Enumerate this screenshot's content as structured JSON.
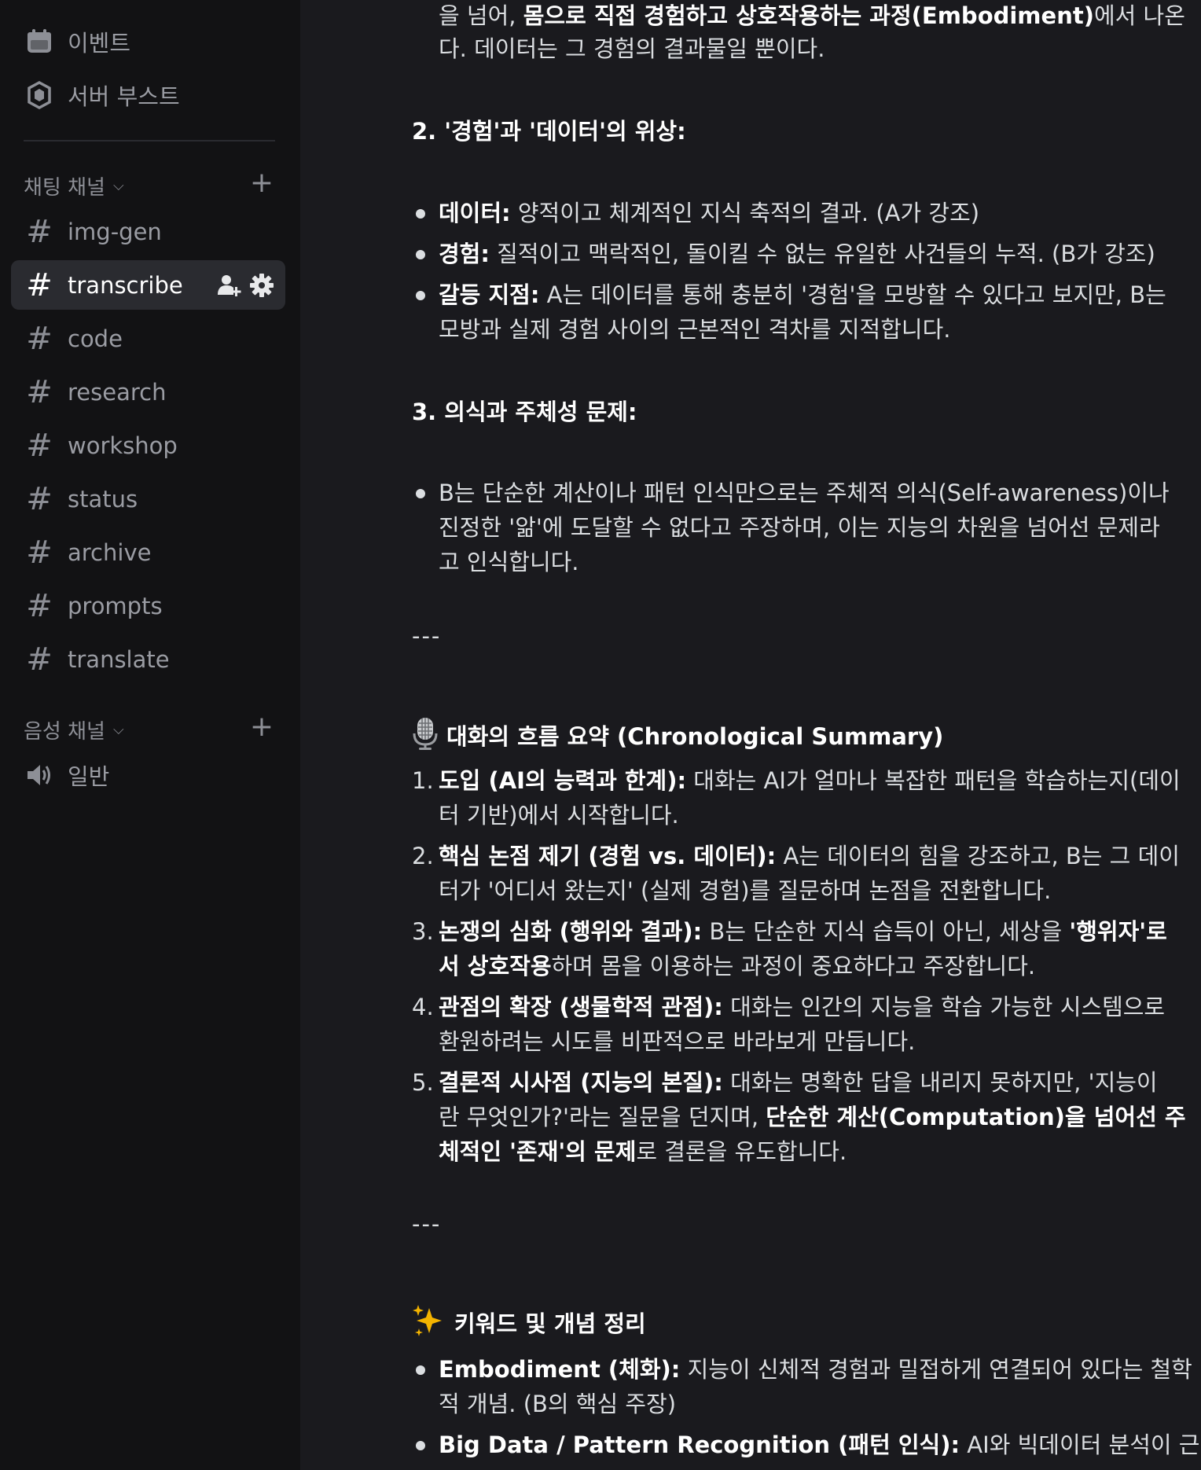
{
  "sidebar": {
    "top_items": [
      {
        "label": "이벤트",
        "icon": "calendar-icon"
      },
      {
        "label": "서버 부스트",
        "icon": "boost-icon"
      }
    ],
    "text_category": {
      "label": "채팅 채널",
      "icon": "chevron-down-icon"
    },
    "channels": [
      "img-gen",
      "transcribe",
      "code",
      "research",
      "workshop",
      "status",
      "archive",
      "prompts",
      "translate"
    ],
    "selected_channel": "transcribe",
    "voice_category": {
      "label": "음성 채널"
    },
    "voice_channels": [
      "일반"
    ]
  },
  "message": {
    "p0_l1_a": "을 넘어, ",
    "p0_l1_b": "몸으로 직접 경험하고 상호작용하는 과정(Embodiment)",
    "p0_l1_c": "에서 나온",
    "p0_l2": "다. 데이터는 그 경험의 결과물일 뿐이다.",
    "s2_heading": "2. '경험'과 '데이터'의 위상:",
    "s2_b1_label": "데이터:",
    "s2_b1_text": " 양적이고 체계적인 지식 축적의 결과. (A가 강조)",
    "s2_b2_label": "경험:",
    "s2_b2_text": " 질적이고 맥락적인, 돌이킬 수 없는 유일한 사건들의 누적. (B가 강조)",
    "s2_b3_label": "갈등 지점:",
    "s2_b3_text1": " A는 데이터를 통해 충분히 '경험'을 모방할 수 있다고 보지만, B는",
    "s2_b3_text2": "모방과 실제 경험 사이의 근본적인 격차를 지적합니다.",
    "s3_heading": "3. 의식과 주체성 문제:",
    "s3_b1_l1": "B는 단순한 계산이나 패턴 인식만으로는 주체적 의식(Self-awareness)이나",
    "s3_b1_l2": "진정한 '앎'에 도달할 수 없다고 주장하며, 이는 지능의 차원을 넘어선 문제라",
    "s3_b1_l3": "고 인식합니다.",
    "separator": "---",
    "flow_heading": "대화의 흐름 요약 (Chronological Summary)",
    "flow": [
      {
        "n": "1.",
        "label": "도입 (AI의 능력과 한계):",
        "l1": " 대화는 AI가 얼마나 복잡한 패턴을 학습하는지(데이",
        "l2": "터 기반)에서 시작합니다."
      },
      {
        "n": "2.",
        "label": "핵심 논점 제기 (경험 vs. 데이터):",
        "l1": " A는 데이터의 힘을 강조하고, B는 그 데이",
        "l2": "터가 '어디서 왔는지' (실제 경험)를 질문하며 논점을 전환합니다."
      },
      {
        "n": "3.",
        "label": "논쟁의 심화 (행위와 결과):",
        "l1": " B는 단순한 지식 습득이 아닌, 세상을 ",
        "l1b": "'행위자'로",
        "l2b": "서 상호작용",
        "l2": "하며 몸을 이용하는 과정이 중요하다고 주장합니다."
      },
      {
        "n": "4.",
        "label": "관점의 확장 (생물학적 관점):",
        "l1": " 대화는 인간의 지능을 학습 가능한 시스템으로",
        "l2": "환원하려는 시도를 비판적으로 바라보게 만듭니다."
      },
      {
        "n": "5.",
        "label": "결론적 시사점 (지능의 본질):",
        "l1": " 대화는 명확한 답을 내리지 못하지만, '지능이",
        "l2a": "란 무엇인가?'라는 질문을 던지며, ",
        "l2b": "단순한 계산(Computation)을 넘어선 주",
        "l3b": "체적인 '존재'의 문제",
        "l3": "로 결론을 유도합니다."
      }
    ],
    "kw_heading": "키워드 및 개념 정리",
    "kw1_label": "Embodiment (체화):",
    "kw1_l1": " 지능이 신체적 경험과 밀접하게 연결되어 있다는 철학",
    "kw1_l2": "적 개념. (B의 핵심 주장)",
    "kw2_label": "Big Data / Pattern Recognition (패턴 인식):",
    "kw2_l1": " AI와 빅데이터 분석이 근거"
  }
}
